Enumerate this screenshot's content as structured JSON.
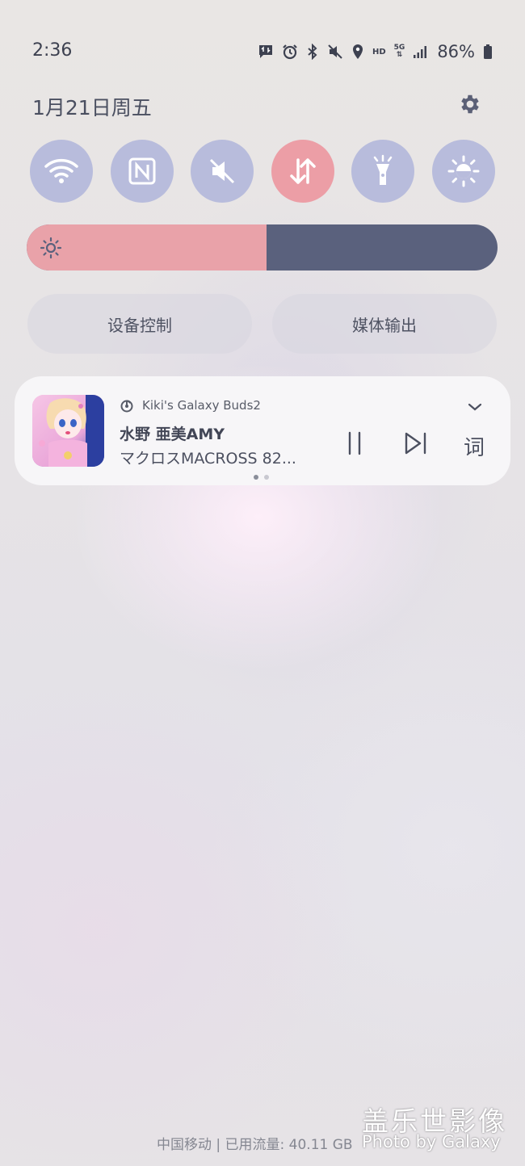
{
  "status_bar": {
    "time": "2:36",
    "hd_label": "HD",
    "network_label": "5G",
    "battery_percent": "86%",
    "icons": [
      "message-icon",
      "alarm-icon",
      "bluetooth-icon",
      "mute-icon",
      "location-icon",
      "hd-icon",
      "5g-icon",
      "signal-icon",
      "battery-icon"
    ]
  },
  "date": "1月21日周五",
  "quick_tiles": [
    {
      "name": "wifi-icon",
      "active": false
    },
    {
      "name": "nfc-icon",
      "active": false
    },
    {
      "name": "sound-off-icon",
      "active": false
    },
    {
      "name": "mobile-data-icon",
      "active": true
    },
    {
      "name": "flashlight-icon",
      "active": false
    },
    {
      "name": "eye-comfort-icon",
      "active": false
    }
  ],
  "brightness": {
    "level": 0.51,
    "icon": "sun-icon"
  },
  "buttons": {
    "device_control": "设备控制",
    "media_output": "媒体输出"
  },
  "media": {
    "device": "Kiki's Galaxy Buds2",
    "title": "水野 亜美AMY",
    "artist": "マクロスMACROSS 82...",
    "lyrics_label": "词",
    "page": 1,
    "pages": 2
  },
  "footer": {
    "carrier": "中国移动 | 已用流量: 40.11 GB"
  },
  "watermark": {
    "title": "盖乐世影像",
    "subtitle": "Photo by Galaxy"
  },
  "colors": {
    "tile": "#b8bcdc",
    "tile_active": "#ec9ea6",
    "brightness_fill": "#e9a2a9",
    "brightness_track": "#5a617d"
  }
}
